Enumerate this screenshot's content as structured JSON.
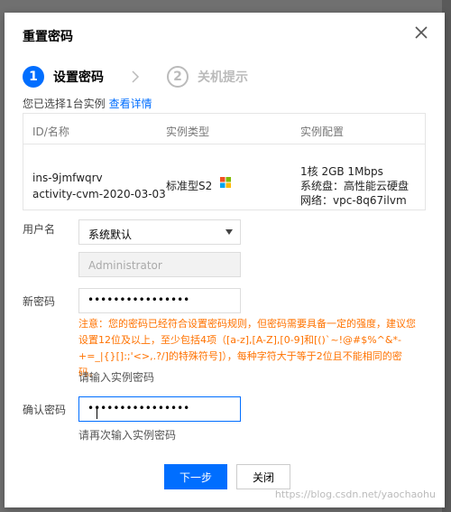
{
  "dialog": {
    "title": "重置密码",
    "steps": [
      {
        "index": "1",
        "label": "设置密码"
      },
      {
        "index": "2",
        "label": "关机提示"
      }
    ],
    "selected_prefix": "您已选择1台实例",
    "details_link": "查看详情"
  },
  "table": {
    "headers": [
      "ID/名称",
      "实例类型",
      "实例配置"
    ],
    "row": {
      "id": "ins-9jmfwqrv",
      "name": "activity-cvm-2020-03-03",
      "type": "标准型S2",
      "config": [
        "1核 2GB 1Mbps",
        "系统盘：高性能云硬盘",
        "网络：vpc-8q67ilvm"
      ]
    }
  },
  "form": {
    "username_label": "用户名",
    "username_select": "系统默认",
    "username_value": "Administrator",
    "new_password_label": "新密码",
    "new_password_mask": "••••••••••••••••",
    "warning": "注意：您的密码已经符合设置密码规则，但密码需要具备一定的强度，建议您设置12位及以上，至少包括4项（[a-z],[A-Z],[0-9]和[()`~!@#$%^&*-+=_|{}[]:;'<>,.?/]的特殊符号]），每种字符大于等于2位且不能相同的密码。",
    "new_password_hint": "请输入实例密码",
    "confirm_label": "确认密码",
    "confirm_password_mask": "••••••••••••••••",
    "confirm_hint": "请再次输入实例密码"
  },
  "buttons": {
    "next": "下一步",
    "close": "关闭"
  },
  "watermark": "https://blog.csdn.net/yaochaohu",
  "colors": {
    "primary": "#006eff",
    "warning": "#ff7200",
    "windows": [
      "#f25022",
      "#7fba00",
      "#00a4ef",
      "#ffb900"
    ]
  }
}
